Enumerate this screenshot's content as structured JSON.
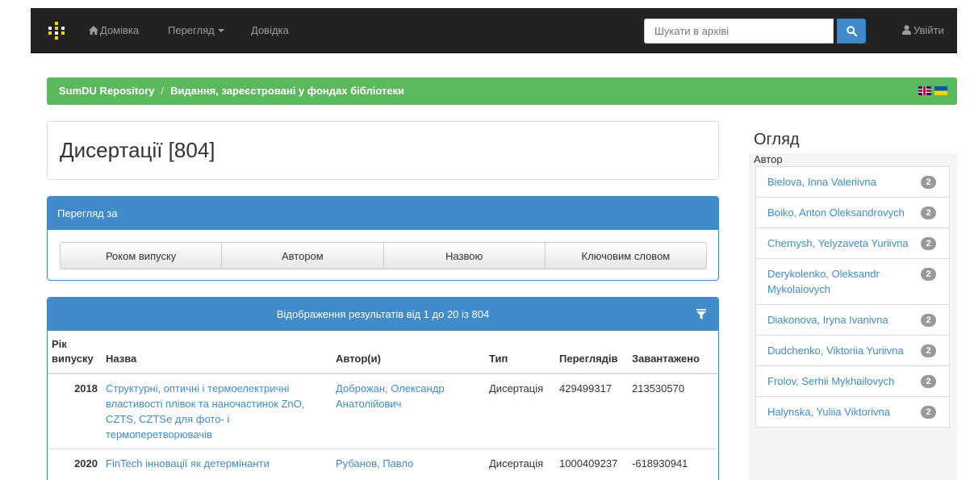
{
  "nav": {
    "home": "Домівка",
    "browse": "Перегляд",
    "help": "Довідка",
    "search_placeholder": "Шукати в архіві",
    "login": "Увійти"
  },
  "breadcrumb": {
    "root": "SumDU Repository",
    "current": "Видання, зареєстровані у фондах бібліотеки"
  },
  "page_title": "Дисертації [804]",
  "browse": {
    "heading": "Перегляд за",
    "buttons": [
      "Роком випуску",
      "Автором",
      "Назвою",
      "Ключовим словом"
    ]
  },
  "results": {
    "heading": "Відображення результатів від 1 до 20 із 804",
    "columns": [
      "Рік випуску",
      "Назва",
      "Автор(и)",
      "Тип",
      "Переглядів",
      "Завантажено"
    ],
    "rows": [
      {
        "year": "2018",
        "title": "Структурні, оптичні і термоелектричні властивості плівок та наночастинок ZnO, CZTS, CZTSe для фото- і термоперетворювачів",
        "author": "Доброжан, Олександр Анатолійович",
        "type": "Дисертація",
        "views": "429499317",
        "downloads": "213530570"
      },
      {
        "year": "2020",
        "title": "FinTech інновації як детермінанти",
        "author": "Рубанов, Павло",
        "type": "Дисертація",
        "views": "1000409237",
        "downloads": "-618930941"
      }
    ]
  },
  "sidebar": {
    "title": "Огляд",
    "section_label": "Автор",
    "items": [
      {
        "name": "Bielova, Inna Valeriivna",
        "count": "2"
      },
      {
        "name": "Boiko, Anton Oleksandrovych",
        "count": "2"
      },
      {
        "name": "Chernysh, Yelyzaveta Yuriivna",
        "count": "2"
      },
      {
        "name": "Derykolenko, Oleksandr Mykolaiovych",
        "count": "2"
      },
      {
        "name": "Diakonova, Iryna Ivanivna",
        "count": "2"
      },
      {
        "name": "Dudchenko, Viktoriia Yuriivna",
        "count": "2"
      },
      {
        "name": "Frolov, Serhii Mykhailovych",
        "count": "2"
      },
      {
        "name": "Halynska, Yuliia Viktorivna",
        "count": "2"
      }
    ]
  },
  "colors": {
    "navbar": "#222222",
    "breadcrumb": "#5cb85c",
    "primary": "#428bca",
    "badge": "#999999"
  }
}
